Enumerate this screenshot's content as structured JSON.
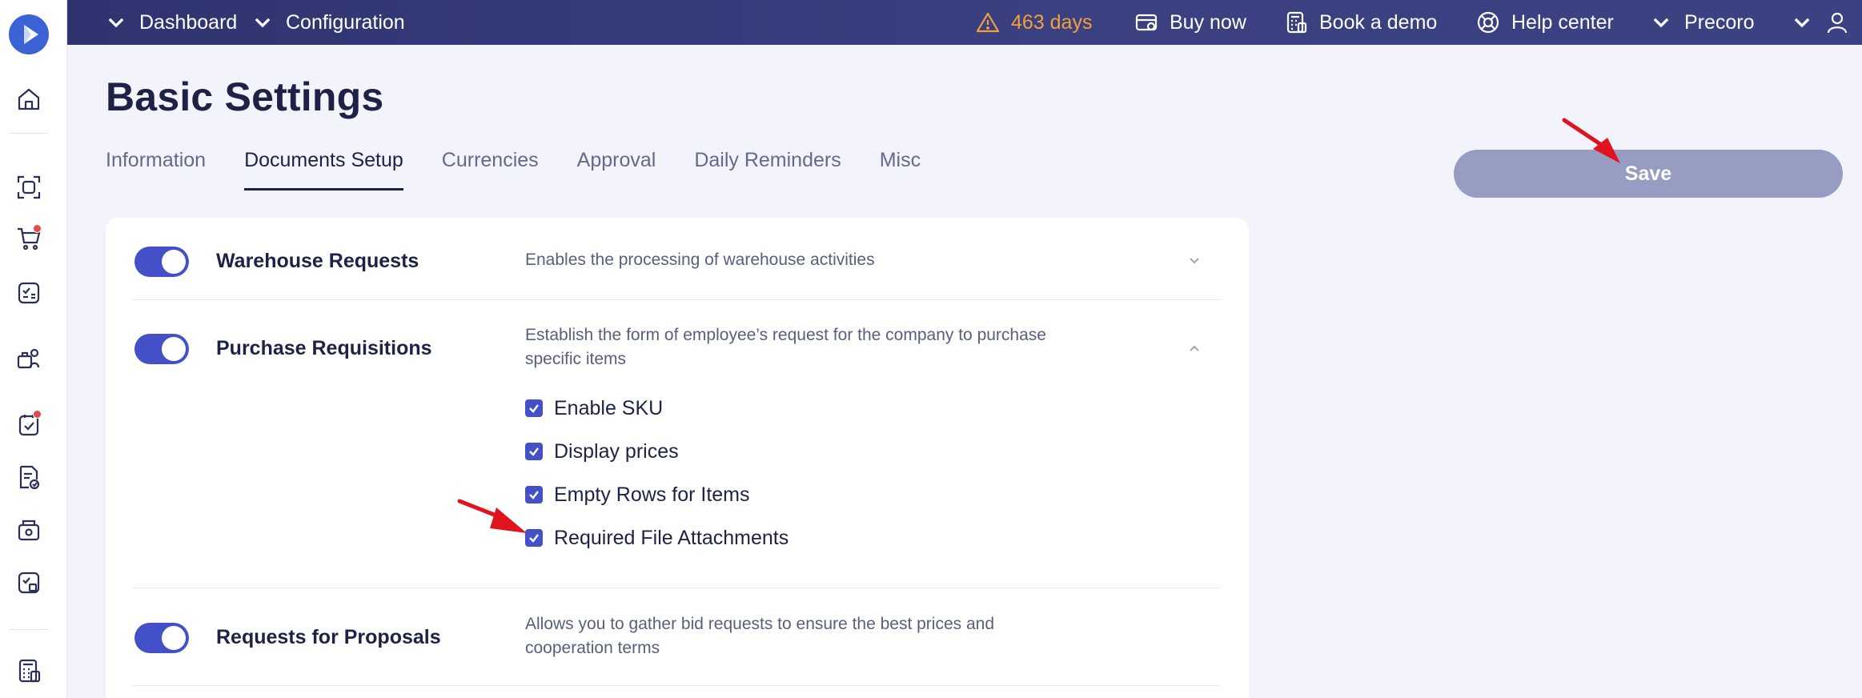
{
  "topbar": {
    "dashboard": "Dashboard",
    "configuration": "Configuration",
    "license_days": "463 days",
    "buy_now": "Buy now",
    "book_demo": "Book a demo",
    "help_center": "Help center",
    "company": "Precoro",
    "warning_color": "#f2a03d"
  },
  "page": {
    "title": "Basic Settings",
    "save_label": "Save"
  },
  "tabs": [
    {
      "label": "Information",
      "active": false
    },
    {
      "label": "Documents Setup",
      "active": true
    },
    {
      "label": "Currencies",
      "active": false
    },
    {
      "label": "Approval",
      "active": false
    },
    {
      "label": "Daily Reminders",
      "active": false
    },
    {
      "label": "Misc",
      "active": false
    }
  ],
  "settings": [
    {
      "title": "Warehouse Requests",
      "description": "Enables the processing of warehouse activities",
      "enabled": true,
      "expanded": false
    },
    {
      "title": "Purchase Requisitions",
      "description": "Establish the form of employee’s request for the company to purchase specific items",
      "enabled": true,
      "expanded": true,
      "options": [
        {
          "label": "Enable SKU",
          "checked": true
        },
        {
          "label": "Display prices",
          "checked": true
        },
        {
          "label": "Empty Rows for Items",
          "checked": true
        },
        {
          "label": "Required File Attachments",
          "checked": true
        }
      ]
    },
    {
      "title": "Requests for Proposals",
      "description": "Allows you to gather bid requests to ensure the best prices and cooperation terms",
      "enabled": true,
      "expanded": false
    }
  ],
  "sidebar": {
    "icons": [
      "logo-icon",
      "home-icon",
      "scan-icon",
      "cart-icon",
      "request-icon",
      "supplier-icon",
      "approval-icon",
      "invoice-icon",
      "payment-icon",
      "receipt-icon",
      "calculator-icon"
    ]
  },
  "colors": {
    "topbar": "#2f3470",
    "accent": "#4450c8",
    "save_button": "#979cc2",
    "annotation_arrow": "#e0141e"
  }
}
